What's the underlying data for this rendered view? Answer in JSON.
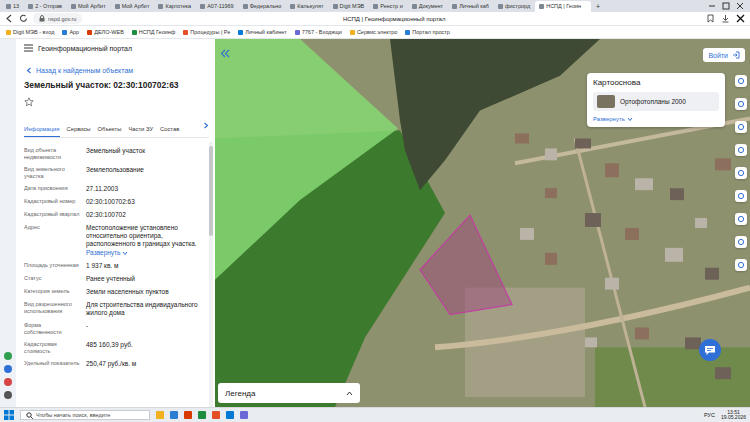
{
  "browser": {
    "tabs": [
      {
        "label": "13",
        "selected": false
      },
      {
        "label": "2 - Отправ",
        "selected": false
      },
      {
        "label": "Мой Арбит",
        "selected": false
      },
      {
        "label": "Мой Арбит",
        "selected": false
      },
      {
        "label": "Картотека",
        "selected": false
      },
      {
        "label": "А07-11969",
        "selected": false
      },
      {
        "label": "Федерально",
        "selected": false
      },
      {
        "label": "Калькулят",
        "selected": false
      },
      {
        "label": "Digit МЭВ",
        "selected": false
      },
      {
        "label": "Реестр и",
        "selected": false
      },
      {
        "label": "Документ",
        "selected": false
      },
      {
        "label": "Личный каб",
        "selected": false
      },
      {
        "label": "фистрорд",
        "selected": false
      },
      {
        "label": "НСПД | Геоин",
        "selected": true
      }
    ],
    "new_tab": "+",
    "url": "nspd.gov.ru",
    "page_title": "НСПД | Геоинформационный портал",
    "bookmarks": [
      "Digit МЭВ - вход",
      "App",
      "ДЕЛО-WEB",
      "НСПД Геоинф",
      "Процедуры | Ре",
      "Личный кабинет",
      "7767 - Входящи",
      "Сервис электро",
      "Портал простр"
    ]
  },
  "portal": {
    "title": "Геоинформационный портал",
    "login": "Войти"
  },
  "panel": {
    "back": "Назад к найденным объектам",
    "heading": "Земельный участок: 02:30:100702:63",
    "tabs": [
      {
        "label": "Информация",
        "selected": true
      },
      {
        "label": "Сервисы",
        "selected": false
      },
      {
        "label": "Объекты",
        "selected": false
      },
      {
        "label": "Части ЗУ",
        "selected": false
      },
      {
        "label": "Состав",
        "selected": false
      }
    ],
    "fields": [
      {
        "label": "Вид объекта недвижимости",
        "value": "Земельный участок"
      },
      {
        "label": "Вид земельного участка",
        "value": "Землепользование"
      },
      {
        "label": "Дата присвоения",
        "value": "27.11.2003"
      },
      {
        "label": "Кадастровый номер",
        "value": "02:30:100702:63"
      },
      {
        "label": "Кадастровый квартал",
        "value": "02:30:100702"
      },
      {
        "label": "Адрес",
        "value": "Местоположение установлено относительно ориентира, расположенного в границах участка.",
        "link": "Развернуть"
      },
      {
        "label": "Площадь уточненная",
        "value": "1 937 кв. м"
      },
      {
        "label": "Статус",
        "value": "Ранее учтенный"
      },
      {
        "label": "Категория земель",
        "value": "Земли населенных пунктов"
      },
      {
        "label": "Вид разрешенного использования",
        "value": "Для строительства индивидуального жилого дома"
      },
      {
        "label": "Форма собственности",
        "value": "-"
      },
      {
        "label": "Кадастровая стоимость",
        "value": "485 160,39 руб."
      },
      {
        "label": "Удельный показатель",
        "value": "250,47 руб./кв. м"
      }
    ]
  },
  "basemap": {
    "title": "Картооснова",
    "option": "Ортофотопланы 2000",
    "expand": "Развернуть"
  },
  "legend": {
    "title": "Легенда"
  },
  "taskbar": {
    "search": "Чтобы начать поиск, введите",
    "lang": "РУС",
    "time": "13:51",
    "date": "19.05.2026"
  }
}
